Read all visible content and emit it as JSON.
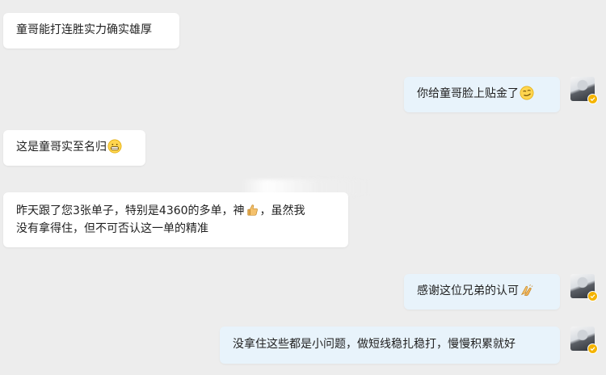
{
  "messages": [
    {
      "side": "left",
      "text": "童哥能打连胜实力确实雄厚"
    },
    {
      "side": "right",
      "text": "你给童哥脸上贴金了",
      "emoji": "smirk-emoji"
    },
    {
      "side": "left",
      "text": "这是童哥实至名归",
      "emoji": "grin-emoji"
    },
    {
      "side": "left",
      "line1_before": "昨天跟了您3张单子，特别是4360的多单，神",
      "line1_emoji": "thumbs-up-emoji",
      "line1_after": "，虽然我",
      "line2": "没有拿得住，但不可否认这一单的精准"
    },
    {
      "side": "right",
      "text": "感谢这位兄弟的认可",
      "emoji": "clasped-hands-emoji"
    },
    {
      "side": "right",
      "text": "没拿住这些都是小问题，做短线稳扎稳打，慢慢积累就好"
    }
  ],
  "colors": {
    "background": "#ededed",
    "left_bubble": "#ffffff",
    "right_bubble": "#e8f3fb",
    "verified_badge": "#f5b400"
  }
}
